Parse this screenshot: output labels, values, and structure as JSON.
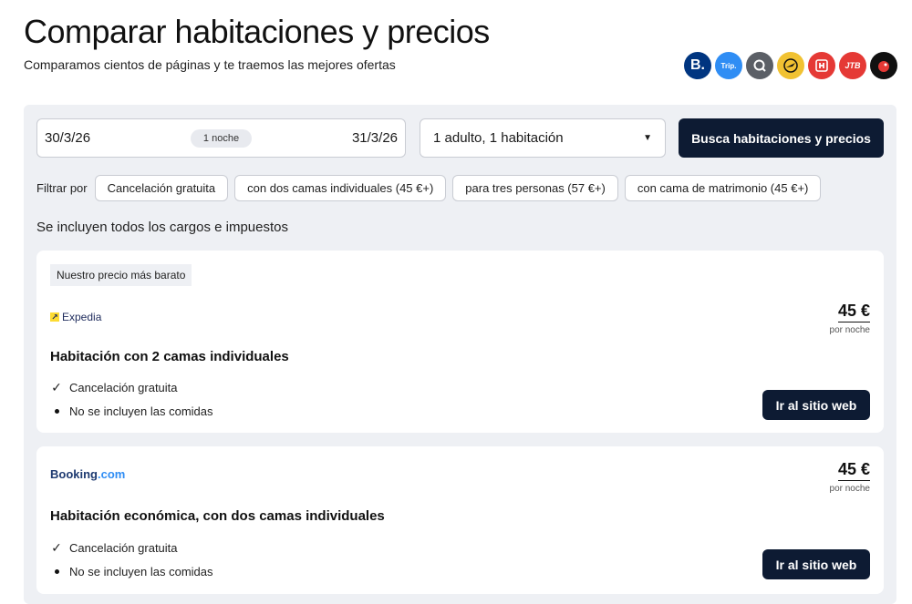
{
  "header": {
    "title": "Comparar habitaciones y precios",
    "subtitle": "Comparamos cientos de páginas y te traemos las mejores ofertas"
  },
  "partners": [
    {
      "name": "booking-icon",
      "glyph": "B."
    },
    {
      "name": "trip-icon",
      "glyph": "Trip."
    },
    {
      "name": "search-partner-icon",
      "glyph": ""
    },
    {
      "name": "plane-partner-icon",
      "glyph": ""
    },
    {
      "name": "hotels-h-icon",
      "glyph": ""
    },
    {
      "name": "jtb-icon",
      "glyph": "JTB"
    },
    {
      "name": "bird-partner-icon",
      "glyph": ""
    }
  ],
  "search": {
    "checkin": "30/3/26",
    "nights": "1 noche",
    "checkout": "31/3/26",
    "guests": "1 adulto, 1 habitación",
    "button": "Busca habitaciones y precios"
  },
  "filters": {
    "label": "Filtrar por",
    "chips": [
      "Cancelación gratuita",
      "con dos camas individuales (45 €+)",
      "para tres personas (57 €+)",
      "con cama de matrimonio (45 €+)"
    ]
  },
  "taxes_note": "Se incluyen todos los cargos e impuestos",
  "offers": [
    {
      "badge": "Nuestro precio más barato",
      "provider": "Expedia",
      "price": "45 €",
      "per_night": "por noche",
      "room": "Habitación con 2 camas individuales",
      "feature_1": "Cancelación gratuita",
      "feature_2": "No se incluyen las comidas",
      "button": "Ir al sitio web"
    },
    {
      "provider_main": "Booking",
      "provider_suffix": ".com",
      "price": "45 €",
      "per_night": "por noche",
      "room": "Habitación económica, con dos camas individuales",
      "feature_1": "Cancelación gratuita",
      "feature_2": "No se incluyen las comidas",
      "button": "Ir al sitio web"
    }
  ]
}
